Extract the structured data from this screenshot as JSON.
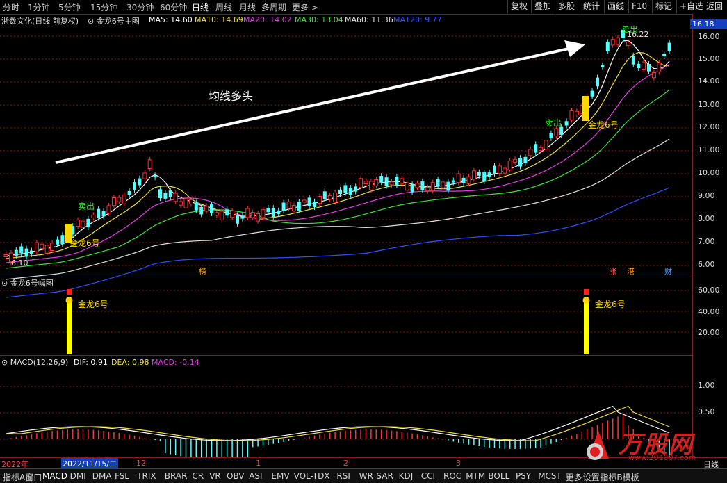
{
  "toolbar": {
    "periods": [
      "分时",
      "1分钟",
      "5分钟",
      "15分钟",
      "30分钟",
      "60分钟",
      "日线",
      "周线",
      "月线",
      "多周期",
      "更多 >"
    ],
    "active_period": "日线",
    "right_buttons": [
      "复权",
      "叠加",
      "多股",
      "统计",
      "画线",
      "F10",
      "标记",
      "+自选",
      "返回"
    ]
  },
  "main_legend": {
    "stock": "浙数文化(日线 前复权)",
    "indicator": "金龙6号主图",
    "ma": [
      {
        "label": "MA5: 14.60",
        "color": "#ffffff"
      },
      {
        "label": "MA10: 14.69",
        "color": "#f0e040"
      },
      {
        "label": "MA20: 14.02",
        "color": "#e040e0"
      },
      {
        "label": "MA30: 13.04",
        "color": "#40e040"
      },
      {
        "label": "MA60: 11.36",
        "color": "#e0e0e0"
      },
      {
        "label": "MA120: 9.77",
        "color": "#3050ff"
      }
    ]
  },
  "price_axis": {
    "top_label": "16.18",
    "ticks": [
      "16.00",
      "15.00",
      "14.00",
      "13.00",
      "12.00",
      "11.00",
      "10.00",
      "9.00",
      "8.00",
      "7.00",
      "6.00"
    ]
  },
  "annotations": {
    "trend_text": "均线多头",
    "low_label": "6.10",
    "high_label": "16.22",
    "sell1": "卖出",
    "sell2": "卖出",
    "sell3": "卖出",
    "gold1": "金龙6号",
    "gold2": "金龙6号",
    "tag_bang": "榜",
    "tag_zhang": "涨",
    "tag_gang": "港",
    "tag_cai": "财"
  },
  "sub1": {
    "title": "金龙6号幅图",
    "ticks": [
      "60.00",
      "40.00",
      "20.00"
    ],
    "label1": "金龙6号",
    "label2": "金龙6号"
  },
  "macd": {
    "title": "MACD(12,26,9)",
    "dif": "DIF: 0.91",
    "dea": "DEA: 0.98",
    "macd": "MACD: -0.14",
    "ticks": [
      "1.00",
      "0.50"
    ]
  },
  "time_axis": {
    "year": "2022年",
    "cursor_date": "2022/11/15/二",
    "months": [
      "12",
      "1",
      "2",
      "3"
    ],
    "right_label": "日线"
  },
  "bottom_tabs": [
    "指标A",
    "窗口",
    "MACD",
    "DMI",
    "DMA",
    "FSL",
    "TRIX",
    "BRAR",
    "CR",
    "VR",
    "OBV",
    "ASI",
    "EMV",
    "VOL-TDX",
    "RSI",
    "WR",
    "SAR",
    "KDJ",
    "CCI",
    "ROC",
    "MTM",
    "BOLL",
    "PSY",
    "MCST",
    "更多",
    "设置",
    "指标B",
    "模板"
  ],
  "watermark": {
    "brand": "万股网",
    "url": "www.20100?.com"
  },
  "colors": {
    "up": "#ff3232",
    "down": "#54ffff",
    "grid": "#8a1b1b",
    "gold": "#ffd700"
  }
}
